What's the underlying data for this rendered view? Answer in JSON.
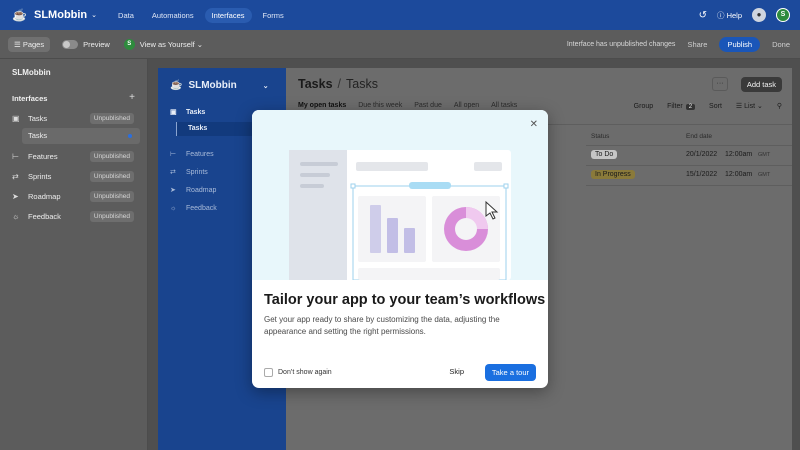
{
  "topbar": {
    "base_name": "SLMobbin",
    "nav": [
      "Data",
      "Automations",
      "Interfaces",
      "Forms"
    ],
    "active_nav": "Interfaces",
    "help": "Help",
    "user_initial": "S"
  },
  "toolbar": {
    "pages": "Pages",
    "preview": "Preview",
    "view_as": "View as Yourself",
    "view_initial": "S",
    "unpublished_notice": "Interface has unpublished changes",
    "share": "Share",
    "publish": "Publish",
    "done": "Done"
  },
  "left_panel": {
    "title": "SLMobbin",
    "section": "Interfaces",
    "items": [
      {
        "label": "Tasks",
        "badge": "Unpublished",
        "icon": "page-icon"
      },
      {
        "label": "Features",
        "badge": "Unpublished",
        "icon": "hierarchy-icon"
      },
      {
        "label": "Sprints",
        "badge": "Unpublished",
        "icon": "shuffle-icon"
      },
      {
        "label": "Roadmap",
        "badge": "Unpublished",
        "icon": "rocket-icon"
      },
      {
        "label": "Feedback",
        "badge": "Unpublished",
        "icon": "lightbulb-icon"
      }
    ],
    "sub_item": "Tasks"
  },
  "app": {
    "name": "SLMobbin",
    "sidebar": {
      "tasks_group": "Tasks",
      "tasks_sub": "Tasks",
      "items": [
        "Features",
        "Sprints",
        "Roadmap",
        "Feedback"
      ]
    },
    "title": "Tasks",
    "title_sub": "Tasks",
    "more": "···",
    "add_task": "Add task",
    "tabs": [
      "My open tasks",
      "Due this week",
      "Past due",
      "All open",
      "All tasks"
    ],
    "tools": {
      "group": "Group",
      "filter": "Filter",
      "filter_count": "2",
      "sort": "Sort",
      "view": "List"
    },
    "columns": {
      "status": "Status",
      "end_date": "End date"
    },
    "rows": [
      {
        "status": "To Do",
        "status_color": "#c6c6c6",
        "date": "20/1/2022",
        "time": "12:00am",
        "tz": "GMT"
      },
      {
        "status": "In Progress",
        "status_color": "#8a7a3a",
        "date": "15/1/2022",
        "time": "12:00am",
        "tz": "GMT"
      }
    ]
  },
  "modal": {
    "title": "Tailor your app to your team’s workflows",
    "body": "Get your app ready to share by customizing the data, adjusting the appearance and setting the right permissions.",
    "dont_show": "Don’t show again",
    "skip": "Skip",
    "tour": "Take a tour",
    "accent": "#1a6fe0"
  }
}
